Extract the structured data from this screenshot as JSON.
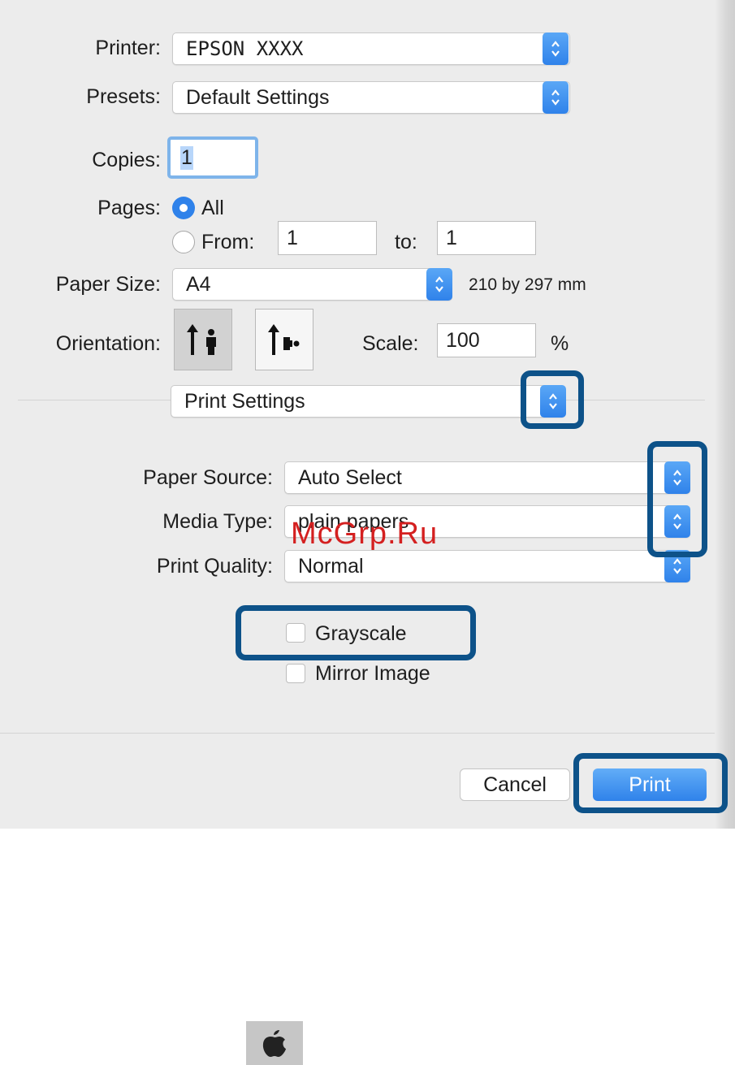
{
  "printer": {
    "label": "Printer:",
    "value": "EPSON XXXX"
  },
  "presets": {
    "label": "Presets:",
    "value": "Default Settings"
  },
  "copies": {
    "label": "Copies:",
    "value": "1"
  },
  "pages": {
    "label": "Pages:",
    "all_label": "All",
    "from_label": "From:",
    "from_value": "1",
    "to_label": "to:",
    "to_value": "1",
    "selected": "All"
  },
  "paper_size": {
    "label": "Paper Size:",
    "value": "A4",
    "dimensions": "210 by 297 mm"
  },
  "orientation": {
    "label": "Orientation:",
    "selected": "portrait"
  },
  "scale": {
    "label": "Scale:",
    "value": "100",
    "unit": "%"
  },
  "panel": {
    "value": "Print Settings"
  },
  "paper_source": {
    "label": "Paper Source:",
    "value": "Auto Select"
  },
  "media_type": {
    "label": "Media Type:",
    "value": "plain papers"
  },
  "print_quality": {
    "label": "Print Quality:",
    "value": "Normal"
  },
  "grayscale": {
    "label": "Grayscale",
    "checked": false
  },
  "mirror_image": {
    "label": "Mirror Image",
    "checked": false
  },
  "buttons": {
    "cancel": "Cancel",
    "print": "Print"
  },
  "watermark": "McGrp.Ru",
  "colors": {
    "accent": "#2f82ea",
    "highlight": "#0d5289",
    "watermark": "#d42020"
  }
}
